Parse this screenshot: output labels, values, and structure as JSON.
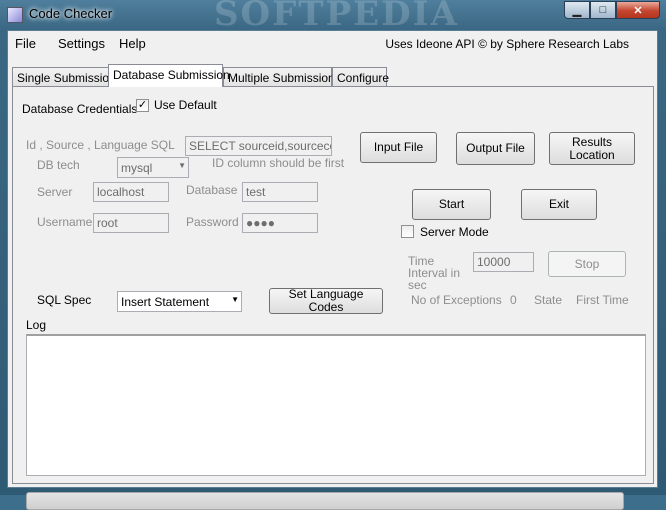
{
  "window": {
    "title": "Code Checker",
    "watermark": "SOFTPEDIA",
    "minimize_glyph": "▁",
    "maximize_glyph": "□",
    "close_glyph": "✕"
  },
  "menu": {
    "items": [
      "File",
      "Settings",
      "Help"
    ],
    "attribution": "Uses Ideone API © by Sphere Research Labs"
  },
  "tabs": [
    "Single Submission",
    "Database Submission",
    "Multiple Submissions",
    "Configure"
  ],
  "active_tab": "Database Submission",
  "db": {
    "credentials_label": "Database Credentials",
    "use_default_label": "Use Default",
    "use_default_checked": true,
    "id_sql_label": "Id , Source , Language SQL",
    "id_sql_value": "SELECT sourceid,sourcecolname",
    "id_hint": "ID column should be first",
    "dbtech_label": "DB tech",
    "dbtech_value": "mysql",
    "server_label": "Server",
    "server_value": "localhost",
    "database_label": "Database",
    "database_value": "test",
    "username_label": "Username",
    "username_value": "root",
    "password_label": "Password",
    "password_value": "●●●●"
  },
  "buttons": {
    "input_file": "Input File",
    "output_file": "Output File",
    "results_location": "Results Location",
    "start": "Start",
    "exit": "Exit",
    "stop": "Stop",
    "set_language_codes": "Set Language Codes"
  },
  "server_mode": {
    "label": "Server Mode",
    "checked": false
  },
  "interval": {
    "label": "Time Interval in sec",
    "value": "10000"
  },
  "sql_spec": {
    "label": "SQL Spec",
    "value": "Insert Statement"
  },
  "status": {
    "exceptions_label": "No of Exceptions",
    "exceptions_value": "0",
    "state_label": "State",
    "state_value": "First Time"
  },
  "log": {
    "label": "Log",
    "content": ""
  },
  "progress": 0
}
